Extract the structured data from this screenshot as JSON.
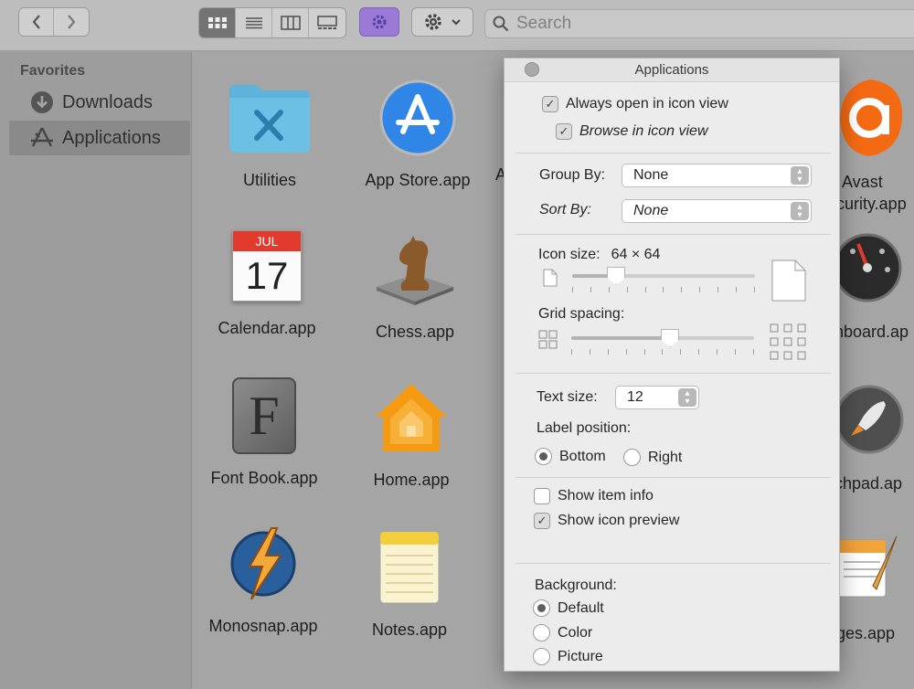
{
  "toolbar": {
    "search_placeholder": "Search",
    "view_modes": [
      "icon-view",
      "list-view",
      "column-view",
      "gallery-view"
    ],
    "active_view": "icon-view"
  },
  "sidebar": {
    "heading": "Favorites",
    "items": [
      {
        "label": "Downloads",
        "icon": "download-icon",
        "selected": false
      },
      {
        "label": "Applications",
        "icon": "applications-icon",
        "selected": true
      }
    ]
  },
  "content": {
    "apps": [
      {
        "label": "Utilities",
        "icon": "utilities-folder-icon"
      },
      {
        "label": "App Store.app",
        "icon": "app-store-icon"
      },
      {
        "label": "Calendar.app",
        "icon": "calendar-icon",
        "calendar_month": "JUL",
        "calendar_day": "17"
      },
      {
        "label": "Chess.app",
        "icon": "chess-icon"
      },
      {
        "label": "Font Book.app",
        "icon": "font-book-icon",
        "glyph": "F"
      },
      {
        "label": "Home.app",
        "icon": "home-icon"
      },
      {
        "label": "Monosnap.app",
        "icon": "monosnap-icon"
      },
      {
        "label": "Notes.app",
        "icon": "notes-icon"
      }
    ],
    "partial_labels": {
      "left_cut": "A",
      "avast_line1": "Avast",
      "avast_line2": "curity.app",
      "dashboard": "hboard.ap",
      "launchpad": "chpad.ap",
      "pages": "ges.app"
    }
  },
  "panel": {
    "title": "Applications",
    "always_open_icon_view": {
      "label": "Always open in icon view",
      "checked": true
    },
    "browse_icon_view": {
      "label": "Browse in icon view",
      "checked": true
    },
    "group_by": {
      "label": "Group By:",
      "value": "None"
    },
    "sort_by": {
      "label": "Sort By:",
      "value": "None"
    },
    "icon_size": {
      "label": "Icon size:",
      "value": "64 × 64",
      "level": 0.24
    },
    "grid_spacing": {
      "label": "Grid spacing:",
      "level": 0.54
    },
    "text_size": {
      "label": "Text size:",
      "value": "12"
    },
    "label_position": {
      "label": "Label position:",
      "options": [
        "Bottom",
        "Right"
      ],
      "selected": "Bottom"
    },
    "show_item_info": {
      "label": "Show item info",
      "checked": false
    },
    "show_icon_preview": {
      "label": "Show icon preview",
      "checked": true
    },
    "background": {
      "label": "Background:",
      "options": [
        "Default",
        "Color",
        "Picture"
      ],
      "selected": "Default"
    }
  },
  "colors": {
    "app_store_blue": "#2f86e6",
    "calendar_red": "#e23b2e",
    "home_orange": "#f39a12",
    "avast_orange": "#f46a12",
    "folder_blue": "#5eb3db",
    "toolbar_active_purple": "#9a7ad6"
  }
}
